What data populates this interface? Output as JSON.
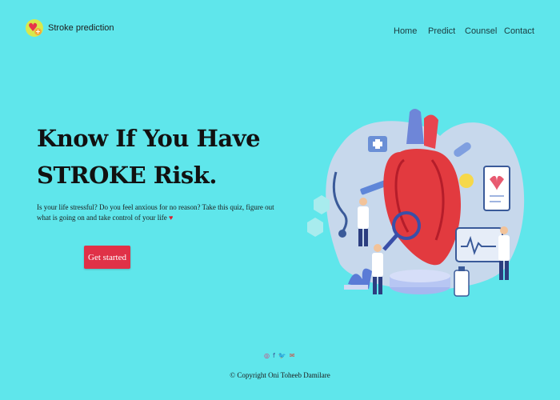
{
  "brand": {
    "name": "Stroke prediction"
  },
  "nav": {
    "home": "Home",
    "predict": "Predict",
    "counsel": "Counsel",
    "contact": "Contact"
  },
  "hero": {
    "title_line1": "Know If You Have",
    "title_line2": "STROKE Risk.",
    "text": "Is your life stressful? Do you feel anxious for no reason? Take this quiz, figure out what is going on and take control of your life",
    "text_heart": "♥",
    "cta_label": "Get started"
  },
  "footer": {
    "instagram": "◎",
    "facebook": "f",
    "twitter": "🐦",
    "email": "✉",
    "copyright": "© Copyright Oni Toheeb Damilare"
  },
  "colors": {
    "background": "#5fe6eb",
    "accent": "#e03147",
    "instagram": "#e1306c",
    "facebook": "#3b5998",
    "twitter": "#1da1f2",
    "email": "#d44638"
  }
}
